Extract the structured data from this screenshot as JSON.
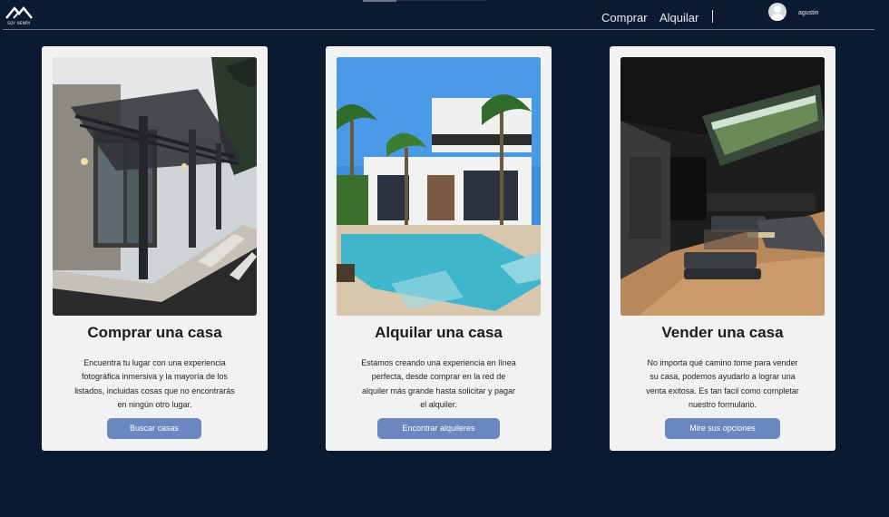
{
  "header": {
    "logo_text": "SOY HENRY",
    "nav": [
      "Comprar",
      "Alquilar"
    ],
    "username": "agustin"
  },
  "cards": [
    {
      "title": "Comprar una casa",
      "description": "Encuentra tu lugar con una experiencia fotográfica inmersiva y la mayoría de los listados, incluidas cosas que no encontrarás en ningún otro lugar.",
      "button": "Buscar casas"
    },
    {
      "title": "Alquilar una casa",
      "description": "Estamos creando una experiencia en línea perfecta, desde comprar en la red de alquiler más grande hasta solicitar y pagar el alquiler.",
      "button": "Encontrar alquileres"
    },
    {
      "title": "Vender una casa",
      "description": "No importa qué camino tome para vender su casa, podemos ayudarlo a lograr una venta exitosa. Es tan facil como completar nuestro formulario.",
      "button": "Mire sus opciones"
    }
  ],
  "colors": {
    "background": "#0b1a31",
    "card": "#f2f2f2",
    "button": "#6a88bf"
  }
}
